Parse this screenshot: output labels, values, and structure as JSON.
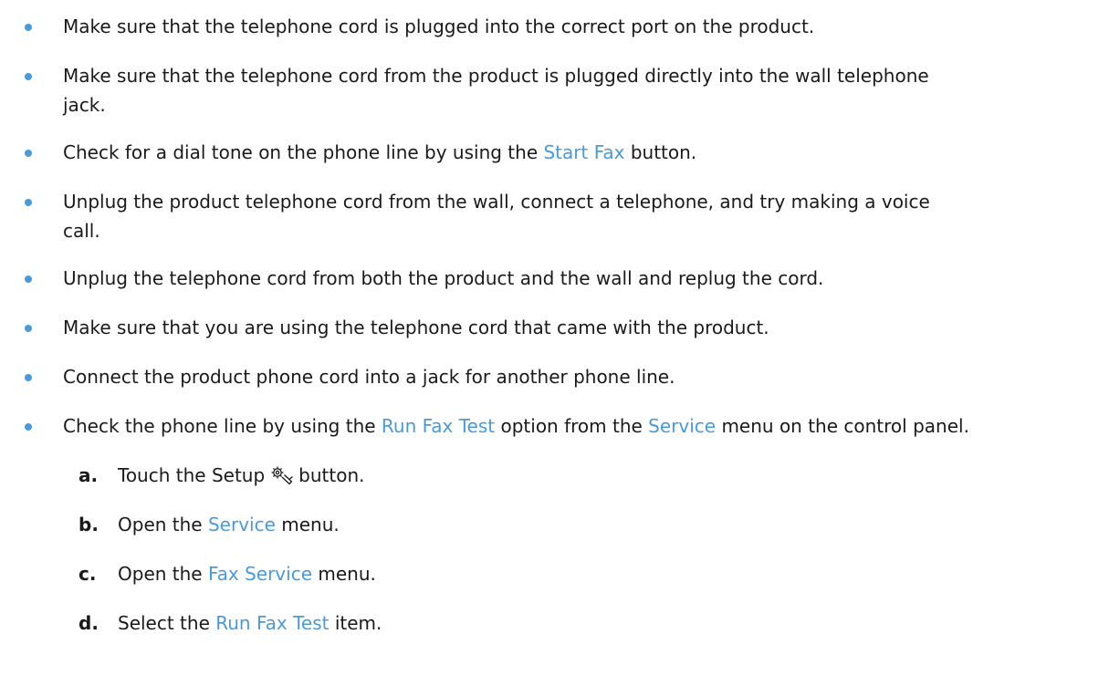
{
  "bullets": [
    {
      "text": "Make sure that the telephone cord is plugged into the correct port on the product."
    },
    {
      "line1": "Make sure that the telephone cord from the product is plugged directly into the wall telephone",
      "line2": "jack."
    },
    {
      "before": "Check for a dial tone on the phone line by using the ",
      "link": "Start Fax",
      "after": " button."
    },
    {
      "line1": "Unplug the product telephone cord from the wall, connect a telephone, and try making a voice",
      "line2": "call."
    },
    {
      "text": "Unplug the telephone cord from both the product and the wall and replug the cord."
    },
    {
      "text": "Make sure that you are using the telephone cord that came with the product."
    },
    {
      "text": "Connect the product phone cord into a jack for another phone line."
    },
    {
      "before": "Check the phone line by using the ",
      "link1": "Run Fax Test",
      "middle": " option from the ",
      "link2": "Service",
      "after": " menu on the control panel."
    }
  ],
  "steps": [
    {
      "letter": "a.",
      "before": "Touch the Setup",
      "icon": "setup-icon",
      "after": "button."
    },
    {
      "letter": "b.",
      "before": "Open the ",
      "link": "Service",
      "after": " menu."
    },
    {
      "letter": "c.",
      "before": "Open the ",
      "link": "Fax Service",
      "after": " menu."
    },
    {
      "letter": "d.",
      "before": "Select the ",
      "link": "Run Fax Test",
      "after": " item."
    }
  ],
  "colors": {
    "link": "#4a9ad8",
    "bullet": "#4a9ad8",
    "text": "#1a1a1a"
  }
}
